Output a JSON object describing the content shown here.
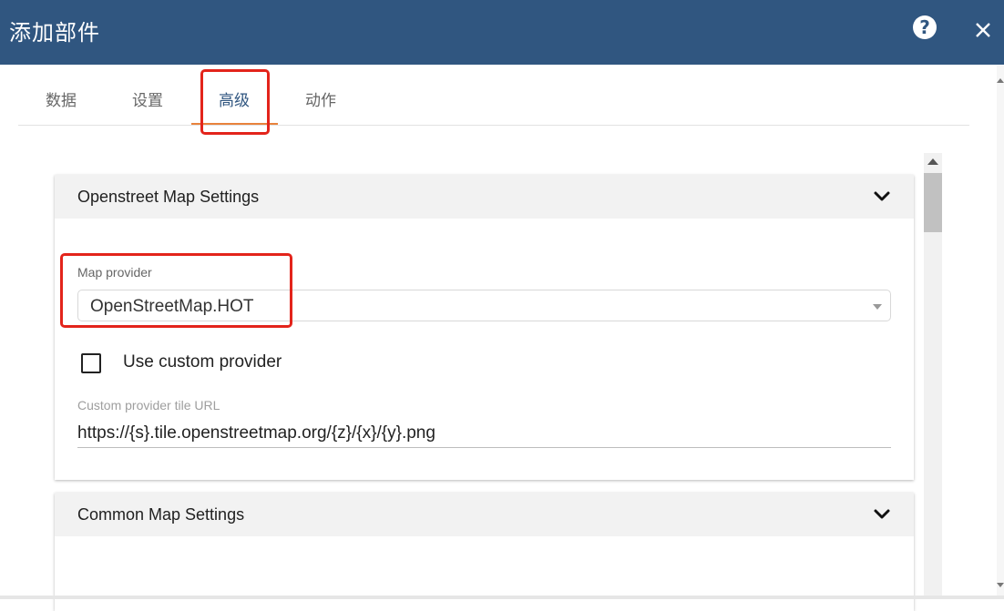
{
  "dialog": {
    "title": "添加部件",
    "help_icon": "question-circle-icon",
    "close_icon": "close-icon"
  },
  "tabs": [
    {
      "label": "数据",
      "active": false
    },
    {
      "label": "设置",
      "active": false
    },
    {
      "label": "高级",
      "active": true
    },
    {
      "label": "动作",
      "active": false
    }
  ],
  "panels": [
    {
      "title": "Openstreet Map Settings",
      "expand_icon": "chevron-down-icon",
      "map_provider_label": "Map provider",
      "map_provider_value": "OpenStreetMap.HOT",
      "custom_provider_label": "Use custom provider",
      "custom_provider_checked": false,
      "tile_url_label": "Custom provider tile URL",
      "tile_url_value": "https://{s}.tile.openstreetmap.org/{z}/{x}/{y}.png"
    },
    {
      "title": "Common Map Settings",
      "expand_icon": "chevron-down-icon"
    }
  ],
  "colors": {
    "header_bg": "#305680",
    "active_tab_text": "#305680",
    "active_tab_ink": "#e8823c",
    "highlight_box": "#e3241b"
  }
}
